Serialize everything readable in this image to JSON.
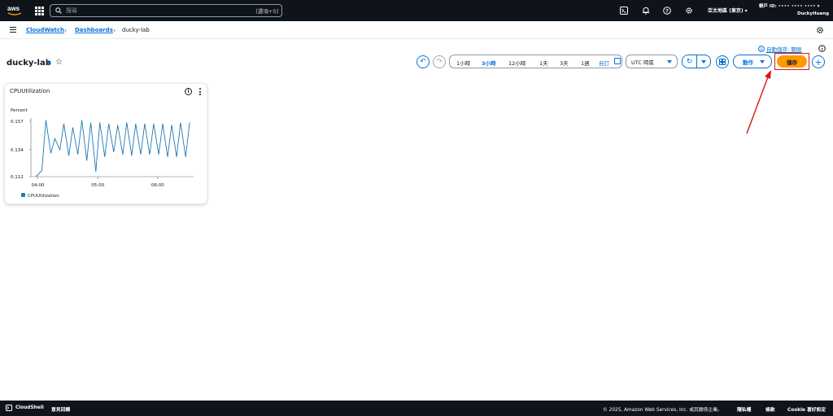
{
  "topnav": {
    "search_placeholder": "搜尋",
    "search_shortcut": "[選項+S]",
    "region": "亞太地區 (東京)",
    "account_label": "帳戶 ID:",
    "account_id_masked": "•••• •••• ••••",
    "user": "DuckyHuang"
  },
  "breadcrumb": {
    "items": [
      "CloudWatch",
      "Dashboards",
      "ducky-lab"
    ]
  },
  "autosave": "自動儲存: 關閉",
  "dashboard": {
    "title": "ducky-lab"
  },
  "time_range": {
    "options": [
      "1小時",
      "3小時",
      "12小時",
      "1天",
      "3天",
      "1週"
    ],
    "selected": "3小時",
    "custom": "自訂"
  },
  "timezone": "UTC 時區",
  "actions_label": "動作",
  "save_label": "儲存",
  "widget": {
    "title": "CPUUtilization"
  },
  "chart_data": {
    "type": "line",
    "title": "CPUUtilization",
    "ylabel": "Percent",
    "yticks": [
      "0.157",
      "0.134",
      "0.112"
    ],
    "xticks": [
      "04:00",
      "05:00",
      "06:00"
    ],
    "ylim": [
      0.112,
      0.157
    ],
    "xlim": [
      "03:53",
      "06:36"
    ],
    "color": "#1f77b4",
    "series": [
      {
        "name": "CPUUtilization",
        "x": [
          "03:58",
          "04:04",
          "04:08",
          "04:13",
          "04:17",
          "04:22",
          "04:26",
          "04:31",
          "04:35",
          "04:40",
          "04:44",
          "04:49",
          "04:53",
          "04:58",
          "05:02",
          "05:07",
          "05:11",
          "05:16",
          "05:20",
          "05:25",
          "05:29",
          "05:34",
          "05:38",
          "05:43",
          "05:47",
          "05:52",
          "05:56",
          "06:01",
          "06:05",
          "06:10",
          "06:14",
          "06:19",
          "06:23",
          "06:28",
          "06:32"
        ],
        "values": [
          0.112,
          0.117,
          0.158,
          0.131,
          0.143,
          0.134,
          0.155,
          0.129,
          0.152,
          0.13,
          0.158,
          0.125,
          0.156,
          0.116,
          0.156,
          0.128,
          0.155,
          0.132,
          0.154,
          0.13,
          0.156,
          0.129,
          0.155,
          0.13,
          0.155,
          0.13,
          0.155,
          0.13,
          0.155,
          0.128,
          0.154,
          0.128,
          0.156,
          0.128,
          0.156
        ]
      }
    ]
  },
  "footer": {
    "cloudshell": "CloudShell",
    "feedback": "意見回饋",
    "copyright": "© 2025, Amazon Web Services, Inc. 或其關係企業。",
    "privacy": "隱私權",
    "terms": "條款",
    "cookies": "Cookie 喜好設定"
  },
  "colors": {
    "accent": "#0972d3",
    "primary_button": "#ff9900",
    "nav_bg": "#0f141a",
    "highlight": "#d91515"
  }
}
